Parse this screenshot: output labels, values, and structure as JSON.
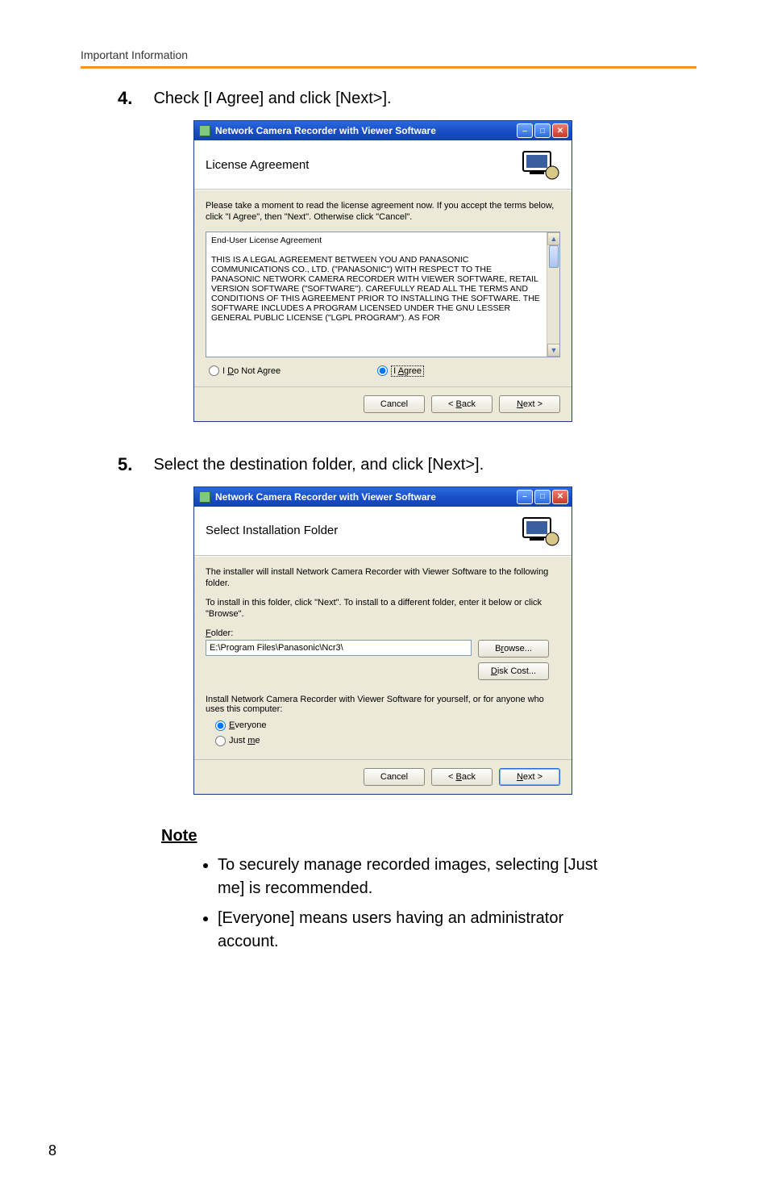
{
  "header": {
    "running": "Important Information"
  },
  "steps": {
    "s4": {
      "num": "4.",
      "text": "Check [I Agree] and click [Next>]."
    },
    "s5": {
      "num": "5.",
      "text": "Select the destination folder, and click [Next>]."
    }
  },
  "dlg1": {
    "title": "Network Camera Recorder with Viewer Software",
    "heading": "License Agreement",
    "instruction": "Please take a moment to read the license agreement now. If you accept the terms below, click \"I Agree\", then \"Next\". Otherwise click \"Cancel\".",
    "eula": "End-User License Agreement\n\nTHIS IS A LEGAL AGREEMENT BETWEEN YOU AND PANASONIC COMMUNICATIONS CO., LTD. (\"PANASONIC\") WITH RESPECT TO THE PANASONIC NETWORK CAMERA RECORDER WITH VIEWER SOFTWARE, RETAIL VERSION SOFTWARE (\"SOFTWARE\"). CAREFULLY READ ALL THE TERMS AND CONDITIONS OF THIS AGREEMENT PRIOR TO INSTALLING THE SOFTWARE. THE SOFTWARE INCLUDES A PROGRAM LICENSED UNDER THE GNU LESSER GENERAL PUBLIC LICENSE (\"LGPL PROGRAM\"). AS FOR",
    "radio_disagree_pre": "I ",
    "radio_disagree_u": "D",
    "radio_disagree_post": "o Not Agree",
    "radio_agree_pre": "I ",
    "radio_agree_u": "A",
    "radio_agree_post": "gree",
    "btn_cancel": "Cancel",
    "btn_back_pre": "< ",
    "btn_back_u": "B",
    "btn_back_post": "ack",
    "btn_next_u": "N",
    "btn_next_post": "ext >"
  },
  "dlg2": {
    "title": "Network Camera Recorder with Viewer Software",
    "heading": "Select Installation Folder",
    "instr1": "The installer will install Network Camera Recorder with Viewer Software to the following folder.",
    "instr2": "To install in this folder, click \"Next\". To install to a different folder, enter it below or click \"Browse\".",
    "folder_label_u": "F",
    "folder_label_post": "older:",
    "folder_value": "E:\\Program Files\\Panasonic\\Ncr3\\",
    "btn_browse_pre": "B",
    "btn_browse_u": "r",
    "btn_browse_post": "owse...",
    "btn_disk_u": "D",
    "btn_disk_post": "isk Cost...",
    "install_for": "Install Network Camera Recorder with Viewer Software for yourself, or for anyone who uses this computer:",
    "opt_everyone_u": "E",
    "opt_everyone_post": "veryone",
    "opt_justme_pre": "Just ",
    "opt_justme_u": "m",
    "opt_justme_post": "e",
    "btn_cancel": "Cancel",
    "btn_back_pre": "< ",
    "btn_back_u": "B",
    "btn_back_post": "ack",
    "btn_next_u": "N",
    "btn_next_post": "ext >"
  },
  "note": {
    "heading": "Note",
    "items": [
      "To securely manage recorded images, selecting [Just me] is recommended.",
      "[Everyone] means users having an administrator account."
    ]
  },
  "page_number": "8"
}
